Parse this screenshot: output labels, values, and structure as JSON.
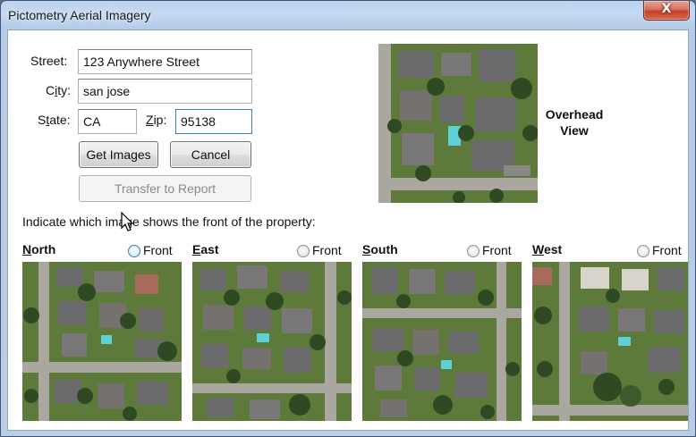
{
  "window": {
    "title": "Pictometry Aerial Imagery",
    "close_glyph": "X"
  },
  "address": {
    "street_label": "Street:",
    "street_value": "123 Anywhere Street",
    "city_label_pre": "C",
    "city_label_accel": "i",
    "city_label_post": "ty:",
    "city_value": "san jose",
    "state_label_pre": "S",
    "state_label_accel": "t",
    "state_label_post": "ate:",
    "state_value": "CA",
    "zip_label_accel": "Z",
    "zip_label_post": "ip:",
    "zip_value": "95138"
  },
  "buttons": {
    "get_images": "Get Images",
    "cancel": "Cancel",
    "transfer": "Transfer to Report"
  },
  "overhead": {
    "label_line1": "Overhead",
    "label_line2": "View"
  },
  "instruction": "Indicate which image shows the front of the property:",
  "directions": [
    {
      "accel": "N",
      "rest": "orth",
      "front_label": "Front"
    },
    {
      "accel": "E",
      "rest": "ast",
      "front_label": "Front"
    },
    {
      "accel": "S",
      "rest": "outh",
      "front_label": "Front"
    },
    {
      "accel": "W",
      "rest": "est",
      "front_label": "Front"
    }
  ],
  "colors": {
    "title_bar": "#bcd3ee",
    "close_button": "#c5402b",
    "focus_border": "#3c7fb1",
    "aerial_roof": "#6b6a6c",
    "aerial_tree": "#2f4a23",
    "aerial_lawn": "#5e7a3a",
    "aerial_road": "#a9a79f",
    "aerial_pool": "#5fd1d6"
  }
}
